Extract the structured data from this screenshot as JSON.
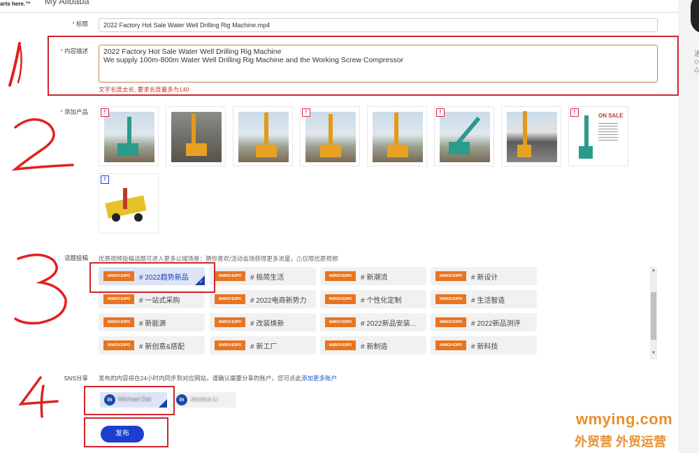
{
  "header": {
    "logo_text": "arts here.™",
    "nav_title": "My Alibaba"
  },
  "form": {
    "title_label": "标题",
    "title_value": "2022 Factory Hot Sale Water Well Drilling Rig Machine.mp4",
    "desc_label": "内容描述",
    "desc_line1": "2022 Factory Hot Sale Water Well Drilling Rig Machine",
    "desc_line2": "We supply 100m-800m Water Well Drilling Rig Machine and the Working Screw Compressor",
    "desc_error": "文字长度太长, 要求长度最多为140",
    "products_label": "添加产品",
    "product_sale_text": "ON SALE",
    "topic_label": "话题投稿",
    "topic_hint": "优质视频投稿话题可进入更多公域场景：猜你喜欢/活动会场获得更多流量，⚠仅限优质视频",
    "tag_badge": "MARCH EXPO",
    "topics": [
      "# 2022趋势新品",
      "# 极简生活",
      "# 新潮流",
      "# 新设计",
      "# 一站式采购",
      "# 2022电商新势力",
      "# 个性化定制",
      "# 生活智造",
      "# 新能源",
      "# 改装焕新",
      "# 2022新品安装...",
      "# 2022新品测评",
      "# 新创意&搭配",
      "# 新工厂",
      "# 新制造",
      "# 新科技"
    ],
    "sns_label": "SNS分享",
    "sns_hint": "发布的内容将在24小时内同步到对应网站，请确认需要分享的账户。您可点此",
    "sns_link": "添加更多账户",
    "accounts": [
      {
        "name": "Michael Dai"
      },
      {
        "name": "Jessica Li"
      }
    ],
    "publish_label": "发布"
  },
  "annotations": {
    "n1": "1",
    "n2": "2",
    "n3": "3",
    "n4": "4"
  },
  "watermark": {
    "line1": "wmying.com",
    "line2": "外贸营 外贸运营"
  },
  "colors": {
    "annotation_red": "#d0242e",
    "primary_blue": "#1d3fcf",
    "tag_orange": "#e8741f",
    "watermark_orange": "#e8902c"
  }
}
